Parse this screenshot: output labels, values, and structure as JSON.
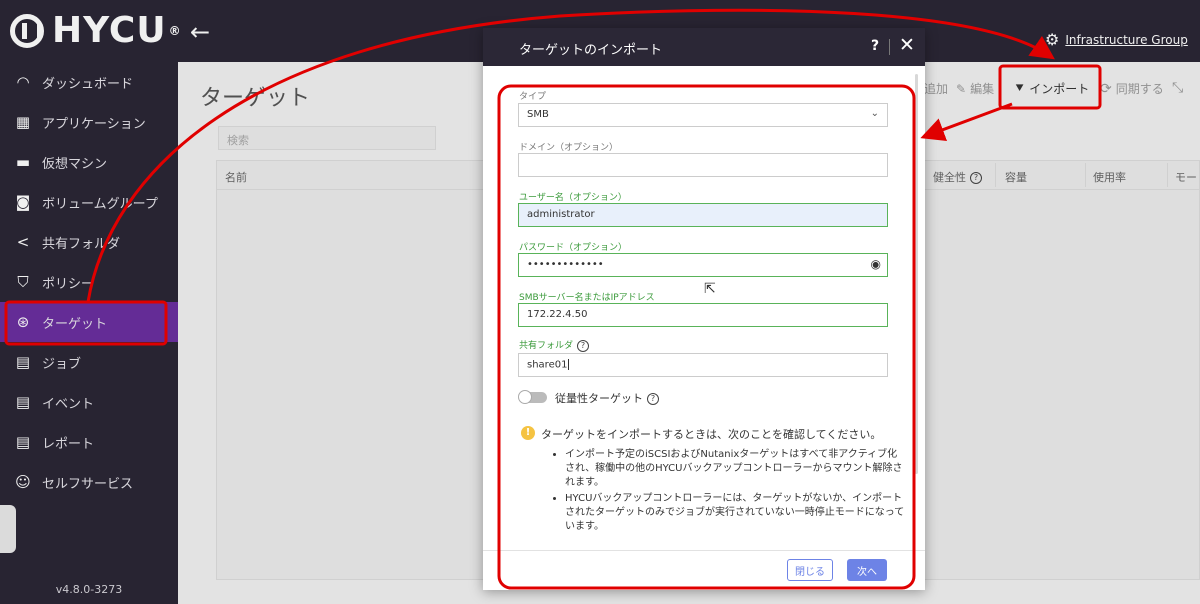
{
  "brand": {
    "name": "HYCU",
    "registered": "®"
  },
  "header": {
    "back_icon": "←",
    "tenant": "Infrastructure Group",
    "tenant_icon": "users-icon"
  },
  "sidebar": {
    "items": [
      {
        "label": "ダッシュボード",
        "icon": "◠"
      },
      {
        "label": "アプリケーション",
        "icon": "▦"
      },
      {
        "label": "仮想マシン",
        "icon": "▬"
      },
      {
        "label": "ボリュームグループ",
        "icon": "◙"
      },
      {
        "label": "共有フォルダ",
        "icon": "<"
      },
      {
        "label": "ポリシー",
        "icon": "⛉"
      },
      {
        "label": "ターゲット",
        "icon": "⊛"
      },
      {
        "label": "ジョブ",
        "icon": "▤"
      },
      {
        "label": "イベント",
        "icon": "▤"
      },
      {
        "label": "レポート",
        "icon": "▤"
      },
      {
        "label": "セルフサービス",
        "icon": "☺"
      }
    ],
    "active_index": 6,
    "version": "v4.8.0-3273"
  },
  "main": {
    "title": "ターゲット",
    "search_placeholder": "検索",
    "columns": [
      "名前",
      "健全性",
      "容量",
      "使用率",
      "モー"
    ],
    "toolbar": {
      "add": "追加",
      "edit": "編集",
      "import": "インポート",
      "sync": "同期する"
    }
  },
  "modal": {
    "title": "ターゲットのインポート",
    "help": "?",
    "close": "✕",
    "fields": {
      "type": {
        "label": "タイプ",
        "value": "SMB"
      },
      "domain": {
        "label": "ドメイン（オプション）",
        "value": ""
      },
      "username": {
        "label": "ユーザー名（オプション）",
        "value": "administrator"
      },
      "password": {
        "label": "パスワード（オプション）",
        "value": "•••••••••••••"
      },
      "server": {
        "label": "SMBサーバー名またはIPアドレス",
        "value": "172.22.4.50"
      },
      "share": {
        "label": "共有フォルダ",
        "value": "share01"
      }
    },
    "toggle_label": "従量性ターゲット",
    "notice": {
      "text": "ターゲットをインポートするときは、次のことを確認してください。",
      "items": [
        "インポート予定のiSCSIおよびNutanixターゲットはすべて非アクティブ化され、稼働中の他のHYCUバックアップコントローラーからマウント解除されます。",
        "HYCUバックアップコントローラーには、ターゲットがないか、インポートされたターゲットのみでジョブが実行されていない一時停止モードになっています。"
      ]
    },
    "buttons": {
      "close": "閉じる",
      "next": "次へ"
    }
  },
  "annotation_color": "#e00000"
}
